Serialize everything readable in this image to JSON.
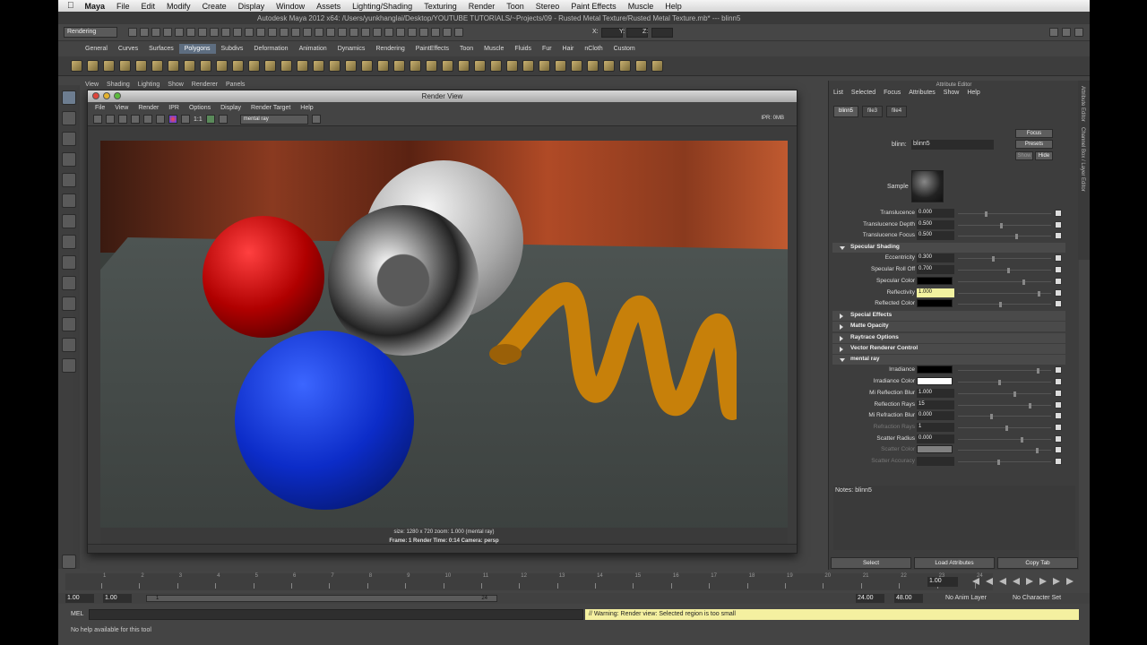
{
  "menubar": {
    "app": "Maya",
    "items": [
      "File",
      "Edit",
      "Modify",
      "Create",
      "Display",
      "Window",
      "Assets",
      "Lighting/Shading",
      "Texturing",
      "Render",
      "Toon",
      "Stereo",
      "Paint Effects",
      "Muscle",
      "Help"
    ]
  },
  "window": {
    "title": "Autodesk Maya 2012 x64: /Users/yunkhanglai/Desktop/YOUTUBE TUTORIALS/~Projects/09 - Rusted Metal Texture/Rusted Metal Texture.mb*  ---  blinn5"
  },
  "statusline": {
    "mode": "Rendering",
    "x_label": "X:",
    "y_label": "Y:",
    "z_label": "Z:"
  },
  "shelf": {
    "tabs": [
      "General",
      "Curves",
      "Surfaces",
      "Polygons",
      "Subdivs",
      "Deformation",
      "Animation",
      "Dynamics",
      "Rendering",
      "PaintEffects",
      "Toon",
      "Muscle",
      "Fluids",
      "Fur",
      "Hair",
      "nCloth",
      "Custom"
    ],
    "active": "Polygons"
  },
  "panel_menu": [
    "View",
    "Shading",
    "Lighting",
    "Show",
    "Renderer",
    "Panels"
  ],
  "render_view": {
    "title": "Render View",
    "menu": [
      "File",
      "View",
      "Render",
      "IPR",
      "Options",
      "Display",
      "Render Target",
      "Help"
    ],
    "ratio": "1:1",
    "renderer": "mental ray",
    "ipr": "IPR: 0MB",
    "info_line1": "size: 1280 x 720  zoom: 1.000        (mental ray)",
    "info_line2": "Frame: 1      Render Time: 0:14      Camera: persp"
  },
  "attribute_editor": {
    "title": "Attribute Editor",
    "menu": [
      "List",
      "Selected",
      "Focus",
      "Attributes",
      "Show",
      "Help"
    ],
    "tabs": [
      "blinn5",
      "file3",
      "file4"
    ],
    "node_label": "blinn:",
    "node_value": "blinn5",
    "focus_btn": "Focus",
    "presets_btn": "Presets",
    "show_btn": "Show",
    "hide_btn": "Hide",
    "sample_label": "Sample",
    "rows": [
      {
        "label": "Translucence",
        "value": "0.000"
      },
      {
        "label": "Translucence Depth",
        "value": "0.500"
      },
      {
        "label": "Translucence Focus",
        "value": "0.500"
      },
      {
        "section": "Specular Shading",
        "open": true
      },
      {
        "label": "Eccentricity",
        "value": "0.300"
      },
      {
        "label": "Specular Roll Off",
        "value": "0.700"
      },
      {
        "label": "Specular Color",
        "color": "#000000"
      },
      {
        "label": "Reflectivity",
        "value": "1.000",
        "highlight": true
      },
      {
        "label": "Reflected Color",
        "color": "#000000"
      },
      {
        "section": "Special Effects",
        "open": false
      },
      {
        "section": "Matte Opacity",
        "open": false
      },
      {
        "section": "Raytrace Options",
        "open": false
      },
      {
        "section": "Vector Renderer Control",
        "open": false
      },
      {
        "section": "mental ray",
        "open": true
      },
      {
        "label": "Irradiance",
        "color": "#000000"
      },
      {
        "label": "Irradiance Color",
        "color": "#ffffff"
      },
      {
        "label": "Mi Reflection Blur",
        "value": "1.000"
      },
      {
        "label": "Reflection Rays",
        "value": "15"
      },
      {
        "label": "Mi Refraction Blur",
        "value": "0.000"
      },
      {
        "label": "Refraction Rays",
        "value": "1",
        "dim": true
      },
      {
        "label": "Scatter Radius",
        "value": "0.000"
      },
      {
        "label": "Scatter Color",
        "color": "#808080",
        "dim": true
      },
      {
        "label": "Scatter Accuracy",
        "value": "",
        "dim": true
      }
    ],
    "notes_label": "Notes:",
    "notes_value": "blinn5",
    "bottom_buttons": [
      "Select",
      "Load Attributes",
      "Copy Tab"
    ]
  },
  "side_tabs": [
    "Attribute Editor",
    "Channel Box / Layer Editor"
  ],
  "timeline": {
    "ticks": [
      "1",
      "2",
      "3",
      "4",
      "5",
      "6",
      "7",
      "8",
      "9",
      "10",
      "11",
      "12",
      "13",
      "14",
      "15",
      "16",
      "17",
      "18",
      "19",
      "20",
      "21",
      "22",
      "23",
      "24"
    ],
    "current_frame": "1.00"
  },
  "range": {
    "start": "1.00",
    "inner_start": "1.00",
    "bar_start": "1",
    "bar_end": "24",
    "end": "24.00",
    "outer_end": "48.00",
    "anim_layer": "No Anim Layer",
    "character_set": "No Character Set"
  },
  "command": {
    "label": "MEL",
    "warning": "// Warning: Render view: Selected region is too small"
  },
  "help_line": "No help available for this tool"
}
